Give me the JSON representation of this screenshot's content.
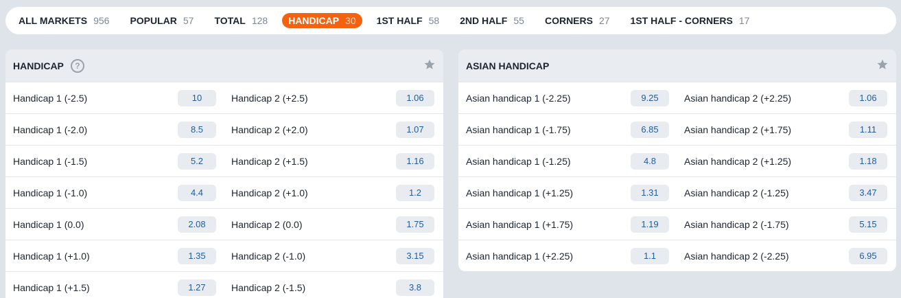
{
  "tabs": [
    {
      "label": "ALL MARKETS",
      "count": "956",
      "active": false
    },
    {
      "label": "POPULAR",
      "count": "57",
      "active": false
    },
    {
      "label": "TOTAL",
      "count": "128",
      "active": false
    },
    {
      "label": "HANDICAP",
      "count": "30",
      "active": true
    },
    {
      "label": "1ST HALF",
      "count": "58",
      "active": false
    },
    {
      "label": "2ND HALF",
      "count": "55",
      "active": false
    },
    {
      "label": "CORNERS",
      "count": "27",
      "active": false
    },
    {
      "label": "1ST HALF - CORNERS",
      "count": "17",
      "active": false
    }
  ],
  "handicap": {
    "title": "HANDICAP",
    "help_symbol": "?",
    "rows": [
      {
        "left_label": "Handicap 1 (-2.5)",
        "left_odd": "10",
        "right_label": "Handicap 2 (+2.5)",
        "right_odd": "1.06"
      },
      {
        "left_label": "Handicap 1 (-2.0)",
        "left_odd": "8.5",
        "right_label": "Handicap 2 (+2.0)",
        "right_odd": "1.07"
      },
      {
        "left_label": "Handicap 1 (-1.5)",
        "left_odd": "5.2",
        "right_label": "Handicap 2 (+1.5)",
        "right_odd": "1.16"
      },
      {
        "left_label": "Handicap 1 (-1.0)",
        "left_odd": "4.4",
        "right_label": "Handicap 2 (+1.0)",
        "right_odd": "1.2"
      },
      {
        "left_label": "Handicap 1 (0.0)",
        "left_odd": "2.08",
        "right_label": "Handicap 2 (0.0)",
        "right_odd": "1.75"
      },
      {
        "left_label": "Handicap 1 (+1.0)",
        "left_odd": "1.35",
        "right_label": "Handicap 2 (-1.0)",
        "right_odd": "3.15"
      },
      {
        "left_label": "Handicap 1 (+1.5)",
        "left_odd": "1.27",
        "right_label": "Handicap 2 (-1.5)",
        "right_odd": "3.8"
      }
    ]
  },
  "asian_handicap": {
    "title": "ASIAN HANDICAP",
    "rows": [
      {
        "left_label": "Asian handicap 1 (-2.25)",
        "left_odd": "9.25",
        "right_label": "Asian handicap 2 (+2.25)",
        "right_odd": "1.06"
      },
      {
        "left_label": "Asian handicap 1 (-1.75)",
        "left_odd": "6.85",
        "right_label": "Asian handicap 2 (+1.75)",
        "right_odd": "1.11"
      },
      {
        "left_label": "Asian handicap 1 (-1.25)",
        "left_odd": "4.8",
        "right_label": "Asian handicap 2 (+1.25)",
        "right_odd": "1.18"
      },
      {
        "left_label": "Asian handicap 1 (+1.25)",
        "left_odd": "1.31",
        "right_label": "Asian handicap 2 (-1.25)",
        "right_odd": "3.47"
      },
      {
        "left_label": "Asian handicap 1 (+1.75)",
        "left_odd": "1.19",
        "right_label": "Asian handicap 2 (-1.75)",
        "right_odd": "5.15"
      },
      {
        "left_label": "Asian handicap 1 (+2.25)",
        "left_odd": "1.1",
        "right_label": "Asian handicap 2 (-2.25)",
        "right_odd": "6.95"
      }
    ]
  },
  "colors": {
    "accent": "#f5620f",
    "odd_text": "#1f5c9e",
    "odd_bg": "#e8ecf0"
  },
  "icons": {
    "help": "help-circle-icon",
    "favorite": "star-icon"
  }
}
